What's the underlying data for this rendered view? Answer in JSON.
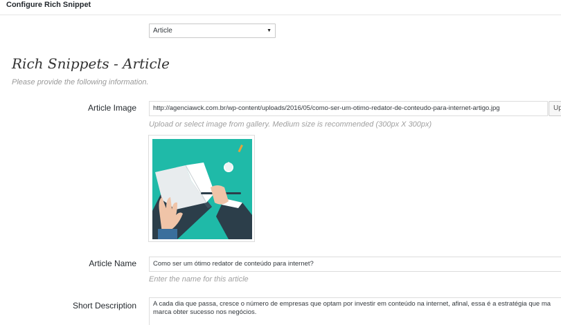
{
  "header": {
    "title": "Configure Rich Snippet"
  },
  "type_select": {
    "value": "Article"
  },
  "section": {
    "title": "Rich Snippets - Article",
    "subtitle": "Please provide the following information."
  },
  "fields": {
    "article_image": {
      "label": "Article Image",
      "value": "http://agenciawck.com.br/wp-content/uploads/2016/05/como-ser-um-otimo-redator-de-conteudo-para-internet-artigo.jpg",
      "button_label": "Up",
      "help": "Upload or select image from gallery. Medium size is recommended (300px X 300px)"
    },
    "article_name": {
      "label": "Article Name",
      "value": "Como ser um ótimo redator de conteúdo para internet?",
      "help": "Enter the name for this article"
    },
    "short_description": {
      "label": "Short Description",
      "line1": "A cada dia que passa, cresce o número de empresas que optam por investir em conteúdo na internet, afinal, essa é a estratégia que ma",
      "line2": "marca obter sucesso nos negócios."
    }
  },
  "colors": {
    "image_bg": "#1fbaa8",
    "text": "#23282d",
    "muted": "#a0a0a0"
  }
}
